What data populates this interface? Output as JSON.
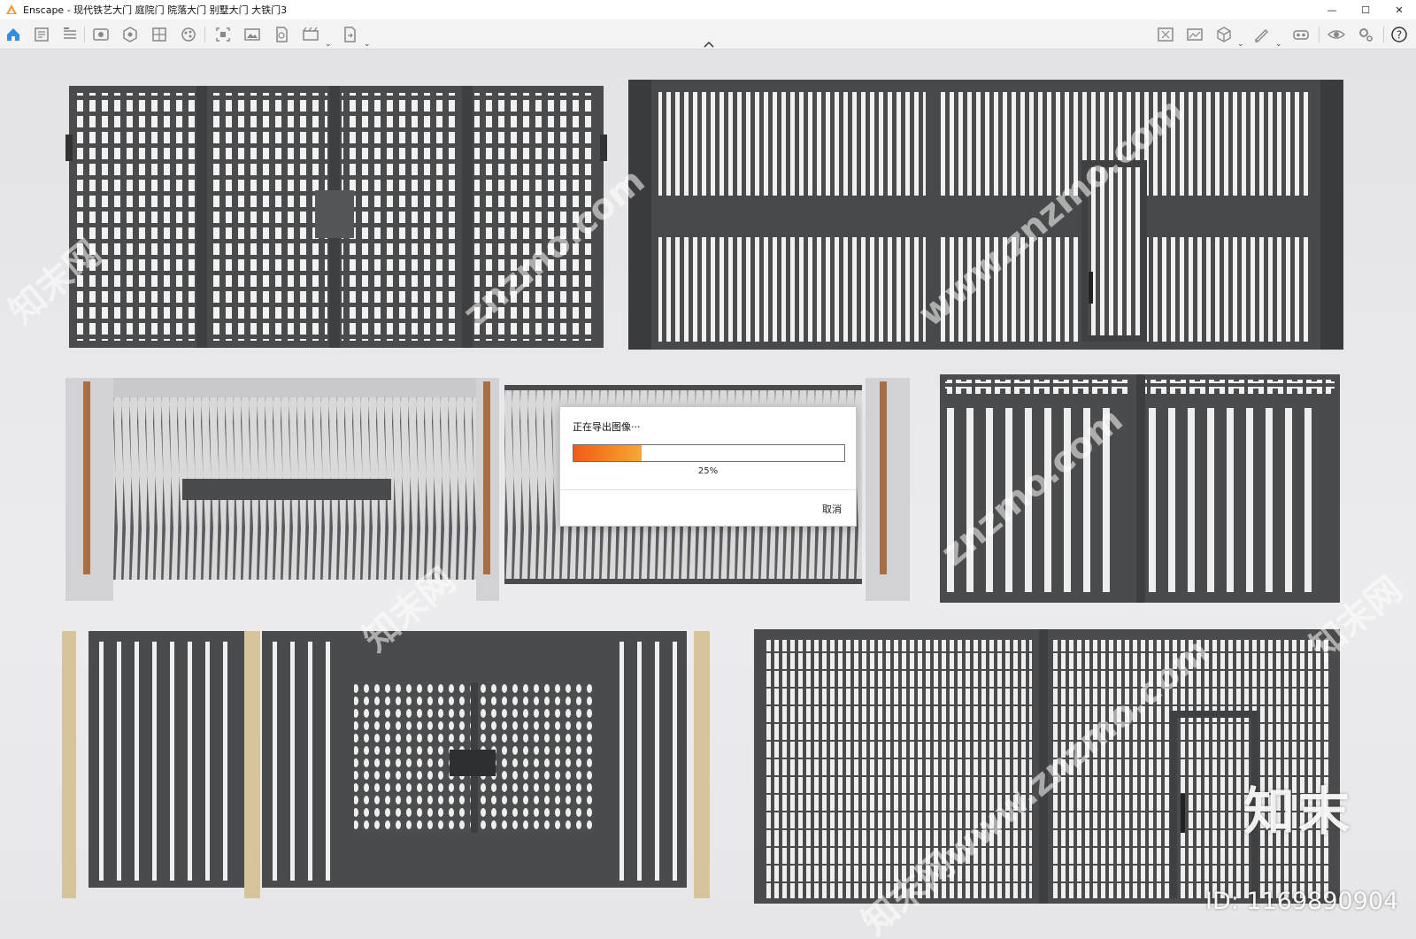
{
  "window": {
    "app_name": "Enscape",
    "title": "Enscape - 现代铁艺大门 庭院门 院落大门 别墅大门 大铁门3",
    "controls": {
      "minimize": "—",
      "maximize": "☐",
      "close": "✕"
    }
  },
  "toolbar": {
    "left_icons": [
      "home-icon",
      "project-info-icon",
      "bim-icon",
      "settings-list-icon",
      "view-eye-icon",
      "asset-library-icon",
      "material-editor-icon",
      "atmosphere-icon",
      "screenshot-icon",
      "image-icon",
      "batch-render-icon",
      "video-icon",
      "export-icon"
    ],
    "right_icons": [
      "minimap-icon",
      "render-image-icon",
      "cube-view-icon",
      "sketch-icon",
      "vr-headset-icon",
      "visual-settings-icon",
      "general-settings-icon",
      "help-icon"
    ]
  },
  "dialog": {
    "title": "正在导出图像···",
    "progress": 0.25,
    "percent_text": "25%",
    "cancel_label": "取消"
  },
  "watermark": {
    "brand": "知末",
    "id_text": "ID: 1169890904",
    "tiles": [
      "知末网",
      "znzmo.com",
      "www.znzmo.com",
      "知末网",
      "znzmo.com",
      "知末网www.znzmo.com",
      "知末网"
    ]
  },
  "colors": {
    "accent": "#f07522",
    "gate_dark": "#4a4b4d",
    "background": "#e4e4e6"
  }
}
